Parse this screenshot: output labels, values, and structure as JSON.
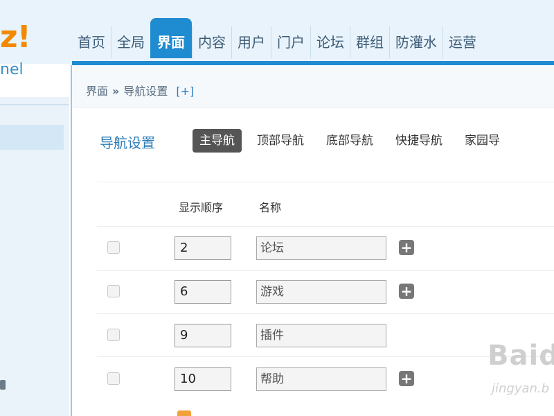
{
  "logo": {
    "text": "z!",
    "subtext": "nel"
  },
  "nav": {
    "items": [
      {
        "label": "首页",
        "active": false
      },
      {
        "label": "全局",
        "active": false
      },
      {
        "label": "界面",
        "active": true
      },
      {
        "label": "内容",
        "active": false
      },
      {
        "label": "用户",
        "active": false
      },
      {
        "label": "门户",
        "active": false
      },
      {
        "label": "论坛",
        "active": false
      },
      {
        "label": "群组",
        "active": false
      },
      {
        "label": "防灌水",
        "active": false
      },
      {
        "label": "运营",
        "active": false
      }
    ]
  },
  "breadcrumb": {
    "root": "界面",
    "separator": "»",
    "current": "导航设置",
    "add": "[+]"
  },
  "section": {
    "title": "导航设置",
    "tabs": [
      {
        "label": "主导航",
        "active": true
      },
      {
        "label": "顶部导航",
        "active": false
      },
      {
        "label": "底部导航",
        "active": false
      },
      {
        "label": "快捷导航",
        "active": false
      },
      {
        "label": "家园导",
        "active": false
      }
    ]
  },
  "table": {
    "headers": {
      "order": "显示顺序",
      "name": "名称"
    },
    "rows": [
      {
        "order": "2",
        "name": "论坛",
        "has_add": true
      },
      {
        "order": "6",
        "name": "游戏",
        "has_add": true
      },
      {
        "order": "9",
        "name": "插件",
        "has_add": false
      },
      {
        "order": "10",
        "name": "帮助",
        "has_add": true
      }
    ]
  },
  "icons": {
    "add": "plus-square-icon",
    "breadcrumb_add": "plus-icon"
  },
  "watermark": {
    "text": "Baidu",
    "subtext": "jingyan.b"
  },
  "colors": {
    "accent": "#1f8bd0",
    "logo": "#f28a00",
    "active_tab": "#555555",
    "title": "#2c7bb5"
  }
}
